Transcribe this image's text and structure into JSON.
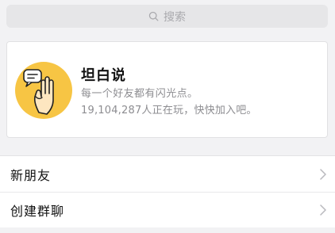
{
  "search": {
    "placeholder": "搜索",
    "icon": "search-icon"
  },
  "card": {
    "title": "坦白说",
    "description": "每一个好友都有闪光点。",
    "stats": "19,104,287人正在玩，快快加入吧。",
    "icon": "hand-speech-bubble-icon",
    "icon_bg_color": "#f7c544"
  },
  "list": {
    "items": [
      {
        "label": "新朋友",
        "icon": "chevron-right-icon"
      },
      {
        "label": "创建群聊",
        "icon": "chevron-right-icon"
      }
    ]
  },
  "colors": {
    "background": "#f2f2f4",
    "search_bg": "#e6e6e8",
    "muted_text": "#8d8d91"
  }
}
